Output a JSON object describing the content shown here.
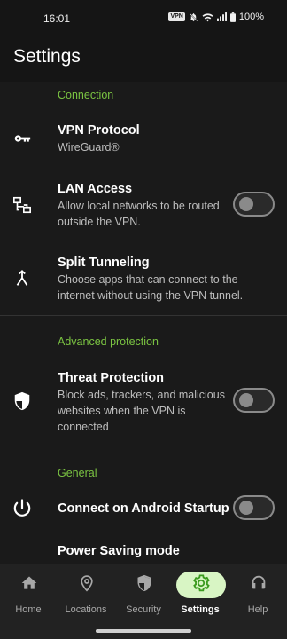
{
  "status_bar": {
    "time": "16:01",
    "vpn_badge": "VPN",
    "battery": "100%",
    "icons": [
      "vpn-chip",
      "notifications-off-icon",
      "wifi-icon",
      "cell-signal-icon",
      "battery-icon"
    ]
  },
  "app_bar": {
    "title": "Settings"
  },
  "sections": {
    "connection": "Connection",
    "advanced": "Advanced protection",
    "general": "General"
  },
  "rows": {
    "vpn_protocol": {
      "title": "VPN Protocol",
      "subtitle": "WireGuard®",
      "icon": "key-icon"
    },
    "lan_access": {
      "title": "LAN Access",
      "subtitle": "Allow local networks to be routed outside the VPN.",
      "icon": "lan-icon",
      "enabled": false
    },
    "split_tunneling": {
      "title": "Split Tunneling",
      "subtitle": "Choose apps that can connect to the internet without using the VPN tunnel.",
      "icon": "merge-icon"
    },
    "threat_protection": {
      "title": "Threat Protection",
      "subtitle": "Block ads, trackers, and malicious websites when the VPN is connected",
      "icon": "shield-icon",
      "enabled": false
    },
    "android_startup": {
      "title": "Connect on Android Startup",
      "icon": "power-icon",
      "enabled": false
    },
    "power_saving": {
      "title": "Power Saving mode"
    }
  },
  "bottom_nav": {
    "active": "settings",
    "items": [
      {
        "id": "home",
        "label": "Home",
        "icon": "home-icon"
      },
      {
        "id": "locations",
        "label": "Locations",
        "icon": "location-pin-icon"
      },
      {
        "id": "security",
        "label": "Security",
        "icon": "shield-icon"
      },
      {
        "id": "settings",
        "label": "Settings",
        "icon": "gear-icon"
      },
      {
        "id": "help",
        "label": "Help",
        "icon": "headset-icon"
      }
    ]
  },
  "colors": {
    "accent_green": "#7bc442",
    "active_pill": "#d8f5c4",
    "background": "#1a1a1a",
    "nav_background": "#222222"
  }
}
